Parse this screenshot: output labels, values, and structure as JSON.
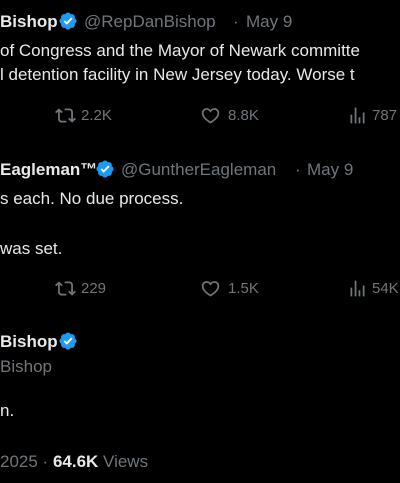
{
  "tweet1": {
    "name": "Bishop",
    "handle": "@RepDanBishop",
    "dot": "·",
    "date": "May 9",
    "line1": "of Congress and the Mayor of Newark committe",
    "line2": "l detention facility in New Jersey today. Worse t",
    "retweets": "2.2K",
    "likes": "8.8K",
    "views": "787"
  },
  "tweet2": {
    "name": "Eagleman™",
    "handle": "@GuntherEagleman",
    "dot": "·",
    "date": "May 9",
    "line1": "s each.  No due process.",
    "line2": "was set.",
    "retweets": "229",
    "likes": "1.5K",
    "views": "54K"
  },
  "tweet3": {
    "name": "Bishop",
    "handle": "Bishop",
    "text": "n.",
    "date_fragment": "2025 ·",
    "views_count": "64.6K",
    "views_label": "Views"
  },
  "colors": {
    "background": "#000000",
    "text": "#e7e9ea",
    "muted": "#71767b",
    "verified": "#1d9bf0"
  },
  "icons": [
    "verified-badge-icon",
    "retweet-icon",
    "like-icon",
    "views-icon"
  ]
}
